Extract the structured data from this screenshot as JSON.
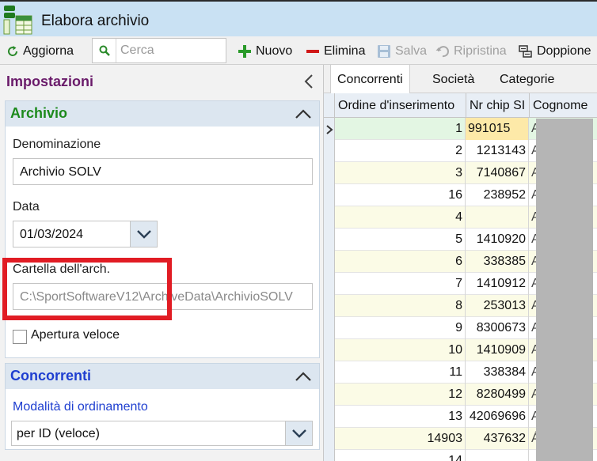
{
  "window": {
    "title": "Elabora archivio"
  },
  "toolbar": {
    "refresh_label": "Aggiorna",
    "search_placeholder": "Cerca",
    "new_label": "Nuovo",
    "delete_label": "Elimina",
    "save_label": "Salva",
    "restore_label": "Ripristina",
    "duplicates_label": "Doppione"
  },
  "settings_panel": {
    "title": "Impostazioni",
    "archive_section": {
      "title": "Archivio",
      "name_label": "Denominazione",
      "name_value": "Archivio SOLV",
      "date_label": "Data",
      "date_value": "01/03/2024",
      "folder_label": "Cartella dell'arch.",
      "folder_value": "C:\\SportSoftwareV12\\ArchiveData\\ArchivioSOLV",
      "fast_open_label": "Apertura veloce",
      "fast_open_checked": false
    },
    "competitors_section": {
      "title": "Concorrenti",
      "sort_label": "Modalità di ordinamento",
      "sort_value": "per ID (veloce)"
    }
  },
  "grid": {
    "tabs": [
      {
        "label": "Concorrenti",
        "active": true
      },
      {
        "label": "Società",
        "active": false
      },
      {
        "label": "Categorie",
        "active": false
      }
    ],
    "columns": [
      "Ordine d'inserimento",
      "Nr chip SI",
      "Cognome"
    ],
    "rows": [
      {
        "order": "1",
        "chip": "991015",
        "surname": "A"
      },
      {
        "order": "2",
        "chip": "1213143",
        "surname": "A"
      },
      {
        "order": "3",
        "chip": "7140867",
        "surname": "A"
      },
      {
        "order": "16",
        "chip": "238952",
        "surname": "A"
      },
      {
        "order": "4",
        "chip": "",
        "surname": "A"
      },
      {
        "order": "5",
        "chip": "1410920",
        "surname": "A"
      },
      {
        "order": "6",
        "chip": "338385",
        "surname": "A"
      },
      {
        "order": "7",
        "chip": "1410912",
        "surname": "A"
      },
      {
        "order": "8",
        "chip": "253013",
        "surname": "A"
      },
      {
        "order": "9",
        "chip": "8300673",
        "surname": "A"
      },
      {
        "order": "10",
        "chip": "1410909",
        "surname": "A"
      },
      {
        "order": "11",
        "chip": "338384",
        "surname": "A"
      },
      {
        "order": "12",
        "chip": "8280499",
        "surname": "A"
      },
      {
        "order": "13",
        "chip": "42069696",
        "surname": "A"
      },
      {
        "order": "14903",
        "chip": "437632",
        "surname": "Á"
      },
      {
        "order": "14",
        "chip": "",
        "surname": ""
      }
    ]
  },
  "colors": {
    "titlebar_bg": "#c9e1f3",
    "panel_title": "#6a1b6a",
    "archive_title": "#1c8a1c",
    "competitors_title": "#1f3fd0",
    "highlight_frame": "#e11c24",
    "current_row": "#e3f6e3",
    "alt_row": "#fbfbe6"
  }
}
